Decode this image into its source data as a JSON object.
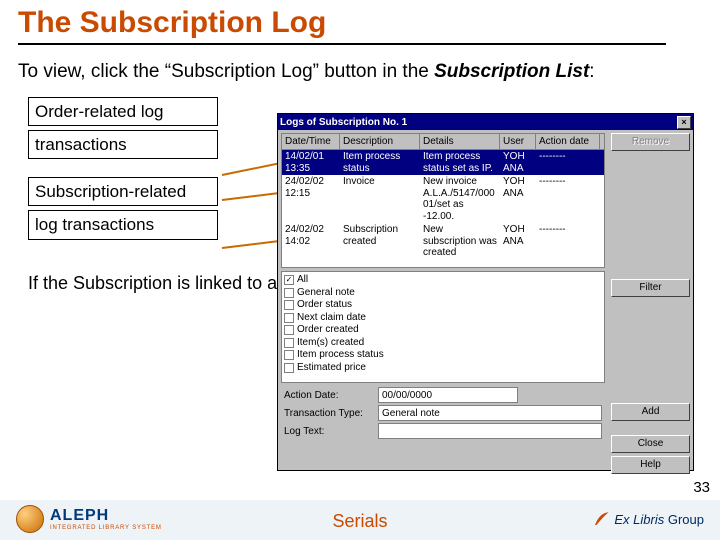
{
  "title": "The Subscription Log",
  "intro": {
    "pre": "To view, click the “Subscription Log” button in the ",
    "emph": "Subscription List",
    "post": ":"
  },
  "labels": {
    "order1": "Order-related log",
    "order2": "transactions",
    "sub1": "Subscription-related",
    "sub2": "log transactions"
  },
  "caption": "If the Subscription is linked to an order, order-related transactions will also display.",
  "dialog": {
    "title": "Logs of Subscription No. 1",
    "headers": [
      "Date/Time",
      "Description",
      "Details",
      "User",
      "Action date"
    ],
    "rows": [
      {
        "dt": "14/02/01 13:35",
        "desc": "Item process status",
        "det": "Item process status set as IP.",
        "user": "YOH ANA",
        "ad": "--------"
      },
      {
        "dt": "24/02/02 12:15",
        "desc": "Invoice",
        "det": "New invoice A.L.A./5147/000 01/set as -12.00.",
        "user": "YOH ANA",
        "ad": "--------"
      },
      {
        "dt": "24/02/02 14:02",
        "desc": "Subscription created",
        "det": "New subscription was created",
        "user": "YOH ANA",
        "ad": "--------"
      }
    ],
    "checks": [
      {
        "checked": true,
        "label": "All"
      },
      {
        "checked": false,
        "label": "General note"
      },
      {
        "checked": false,
        "label": "Order status"
      },
      {
        "checked": false,
        "label": "Next claim date"
      },
      {
        "checked": false,
        "label": "Order created"
      },
      {
        "checked": false,
        "label": "Item(s) created"
      },
      {
        "checked": false,
        "label": "Item process status"
      },
      {
        "checked": false,
        "label": "Estimated price"
      }
    ],
    "form": {
      "actionDateLabel": "Action Date:",
      "actionDateValue": "00/00/0000",
      "transTypeLabel": "Transaction Type:",
      "transTypeValue": "General note",
      "logTextLabel": "Log Text:",
      "logTextValue": ""
    },
    "buttons": {
      "remove": "Remove Ac.Date",
      "filter": "Filter",
      "add": "Add",
      "close": "Close",
      "help": "Help"
    }
  },
  "footer": {
    "aleph": "ALEPH",
    "atag": "INTEGRATED LIBRARY SYSTEM",
    "center": "Serials",
    "exlibris": "Ex Libris",
    "exlibris2": "Group"
  },
  "page": "33"
}
